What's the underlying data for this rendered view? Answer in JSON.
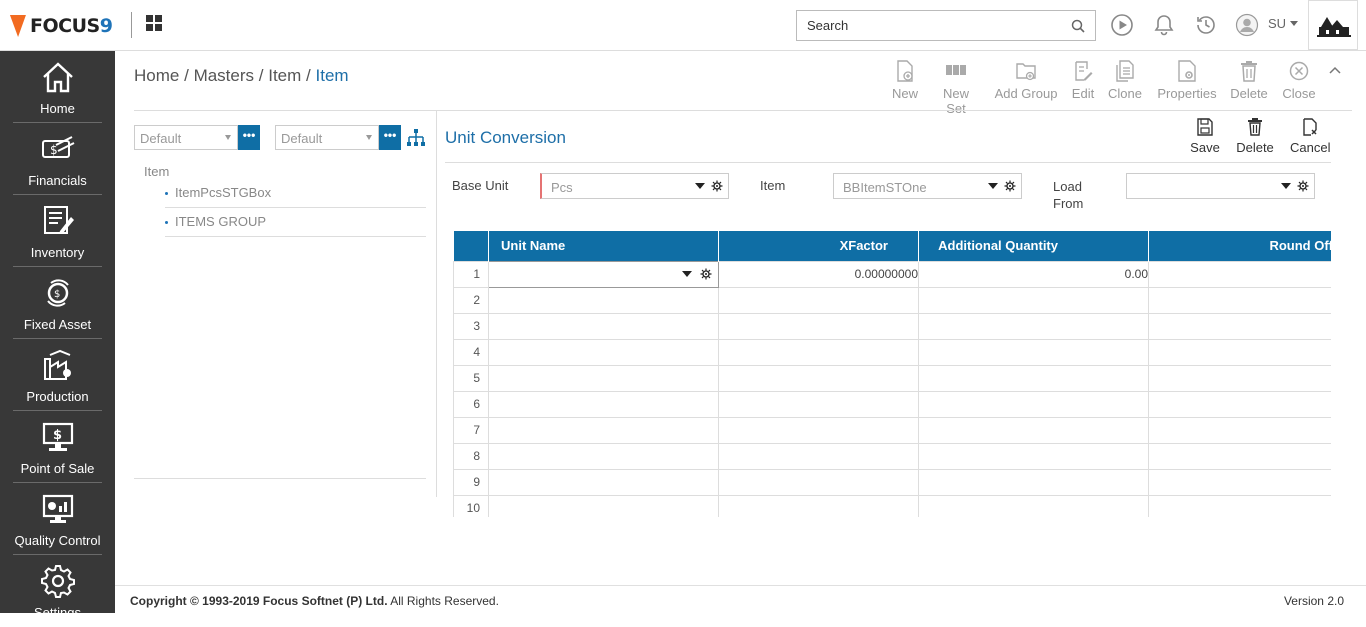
{
  "topbar": {
    "brand_name": "FOCUS",
    "brand_num": "9",
    "search_placeholder": "Search",
    "user": "SU"
  },
  "sidebar": {
    "items": [
      {
        "label": "Home",
        "icon": "home-icon"
      },
      {
        "label": "Financials",
        "icon": "financials-icon"
      },
      {
        "label": "Inventory",
        "icon": "inventory-icon"
      },
      {
        "label": "Fixed Asset",
        "icon": "fixed-asset-icon"
      },
      {
        "label": "Production",
        "icon": "production-icon"
      },
      {
        "label": "Point of Sale",
        "icon": "point-of-sale-icon"
      },
      {
        "label": "Quality Control",
        "icon": "quality-control-icon"
      },
      {
        "label": "Settings",
        "icon": "settings-icon"
      }
    ]
  },
  "breadcrumb": {
    "home": "Home",
    "masters": "Masters",
    "item": "Item",
    "current": "Item",
    "sep": "/"
  },
  "toolbar": {
    "new": "New",
    "new_set": "New Set",
    "add_group": "Add Group",
    "edit": "Edit",
    "clone": "Clone",
    "properties": "Properties",
    "delete": "Delete",
    "close": "Close"
  },
  "left_panel": {
    "filter1": "Default",
    "filter2": "Default",
    "dots": "•••",
    "tree_root": "Item",
    "nodes": [
      "ItemPcsSTGBox",
      "ITEMS GROUP"
    ]
  },
  "unit_conversion": {
    "title": "Unit Conversion",
    "save": "Save",
    "delete": "Delete",
    "cancel": "Cancel",
    "base_unit_label": "Base Unit",
    "base_unit_value": "Pcs",
    "item_label": "Item",
    "item_value": "BBItemSTOne",
    "load_from_label_1": "Load",
    "load_from_label_2": "From",
    "load_from_value": ""
  },
  "grid": {
    "columns": [
      "Unit Name",
      "XFactor",
      "Additional Quantity",
      "Round Off"
    ],
    "rows": [
      {
        "num": "1",
        "unit_name": "",
        "xfactor": "0.00000000",
        "additional_qty": "0.00"
      },
      {
        "num": "2"
      },
      {
        "num": "3"
      },
      {
        "num": "4"
      },
      {
        "num": "5"
      },
      {
        "num": "6"
      },
      {
        "num": "7"
      },
      {
        "num": "8"
      },
      {
        "num": "9"
      },
      {
        "num": "10"
      }
    ]
  },
  "footer": {
    "copyright_bold": "Copyright © 1993-2019 Focus Softnet (P) Ltd.",
    "copyright_rest": " All Rights Reserved.",
    "version": "Version 2.0"
  },
  "colors": {
    "accent": "#0f6ea5",
    "sidebar_bg": "#383838",
    "brand_orange": "#f26b21"
  }
}
